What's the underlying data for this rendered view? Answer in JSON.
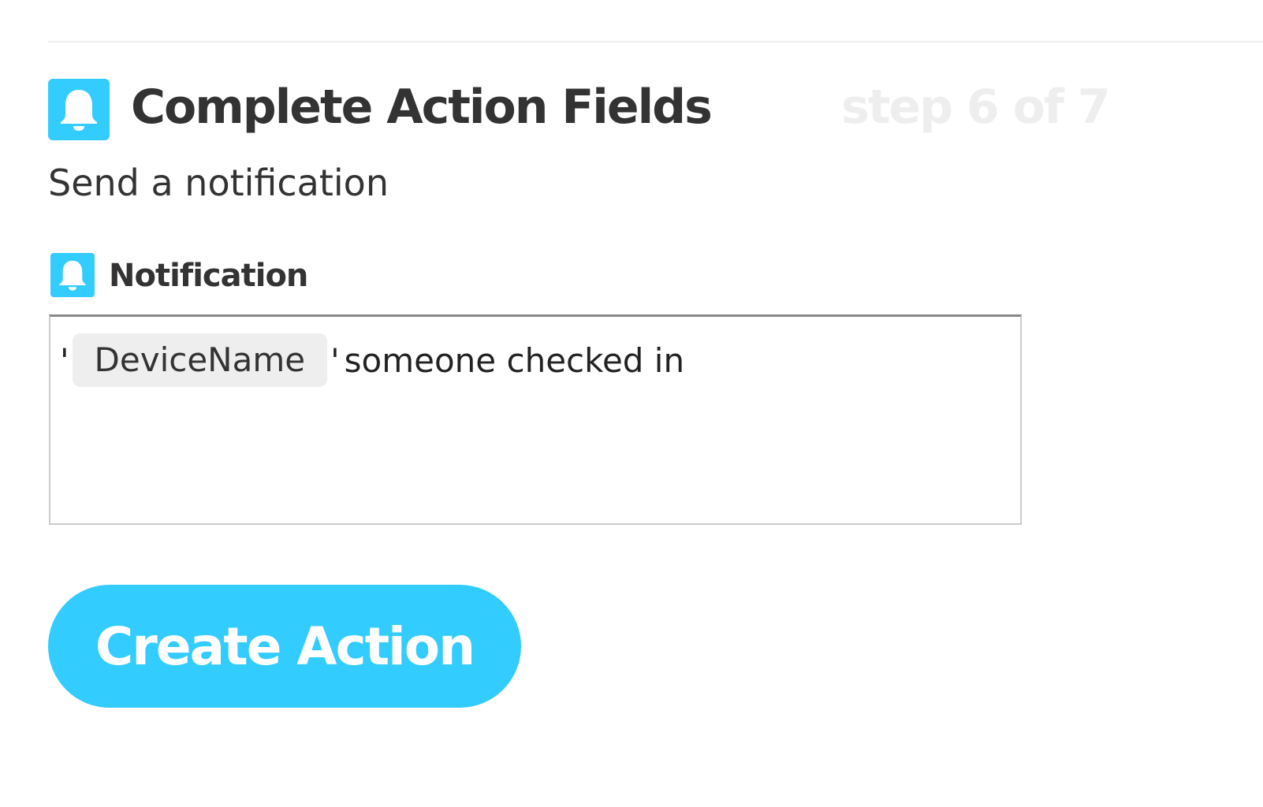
{
  "header": {
    "icon": "bell-icon",
    "title": "Complete Action Fields",
    "step": "step 6 of 7"
  },
  "subtitle": "Send a notification",
  "field": {
    "icon": "bell-icon",
    "label": "Notification",
    "value": {
      "quote_open": "'",
      "ingredient": "DeviceName",
      "quote_close": "'",
      "text": "someone checked in"
    }
  },
  "actions": {
    "create_label": "Create Action"
  },
  "colors": {
    "accent": "#33ccff",
    "step_text": "#eeeeee",
    "ingredient_bg": "#eeeeee"
  }
}
